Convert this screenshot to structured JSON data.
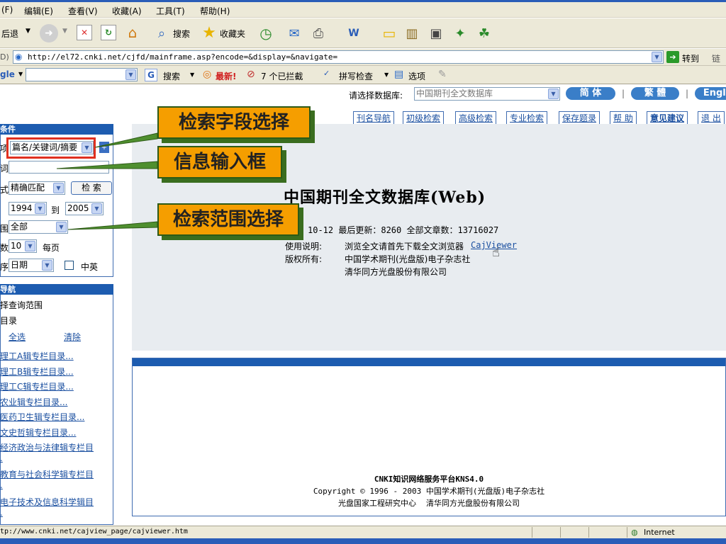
{
  "menu": [
    "(F)",
    "编辑(E)",
    "查看(V)",
    "收藏(A)",
    "工具(T)",
    "帮助(H)"
  ],
  "toolbar": {
    "back": "后退",
    "search": "搜索",
    "favorites": "收藏夹"
  },
  "address": {
    "label": "D)",
    "url": "http://el72.cnki.net/cjfd/mainframe.asp?encode=&display=&navigate=",
    "go": "转到",
    "links": "链接"
  },
  "gbar": {
    "logo": "gle",
    "search": "搜索",
    "new": "最新!",
    "blocked": "7 个已拦截",
    "spell": "拼写检查",
    "options": "选项"
  },
  "db": {
    "label": "请选择数据库:",
    "value": "中国期刊全文数据库",
    "btn_simple": "简 体",
    "btn_trad": "繁 體",
    "btn_en": "Engli"
  },
  "tabs": [
    "刊名导航",
    "初级检索",
    "高级检索",
    "专业检索",
    "保存题录",
    "帮 助",
    "意见建议",
    "退 出"
  ],
  "left": {
    "head1": "条件",
    "field_label": "项",
    "field_value": "篇名/关键词/摘要",
    "word_label": "词",
    "mode_label": "式",
    "mode_value": "精确匹配",
    "search_btn": "检 索",
    "year_from": "1994",
    "year_to_label": "到",
    "year_to": "2005",
    "range_label": "围",
    "range_value": "全部",
    "count_label": "数",
    "count_value": "10",
    "per_page": "每页",
    "sort_label": "序",
    "sort_value": "日期",
    "zhongying": "中英",
    "head2": "导航",
    "choose_range": "择查询范围",
    "catalog": "目录",
    "select_all": "全选",
    "clear": "清除",
    "cats": [
      "理工A辑专栏目录...",
      "理工B辑专栏目录...",
      "理工C辑专栏目录...",
      "农业辑专栏目录...",
      "医药卫生辑专栏目录...",
      "文史哲辑专栏目录...",
      "经济政治与法律辑专栏目",
      ".",
      "教育与社会科学辑专栏目",
      ".",
      "电子技术及信息科学辑目",
      "."
    ]
  },
  "main": {
    "title": "中国期刊全文数据库(Web)",
    "stats": "10-12 最后更新：8260 全部文章数：13716027",
    "usage_label": "使用说明:",
    "usage_text": "浏览全文请首先下载全文浏览器",
    "usage_link": "CajViewer",
    "rights_label": "版权所有:",
    "rights_1": "中国学术期刊(光盘版)电子杂志社",
    "rights_2": "清华同方光盘股份有限公司"
  },
  "footer": {
    "line1": "CNKI知识网络服务平台KNS4.0",
    "line2": "Copyright © 1996 - 2003  中国学术期刊(光盘版)电子杂志社",
    "line3": "光盘国家工程研究中心    清华同方光盘股份有限公司"
  },
  "callouts": {
    "c1": "检索字段选择",
    "c2": "信息输入框",
    "c3": "检索范围选择"
  },
  "status": {
    "url": "tp://www.cnki.net/cajview_page/cajviewer.htm",
    "zone": "Internet"
  },
  "colors": {
    "accent": "#1d5cb0",
    "callout": "#f59e00",
    "callout_border": "#2d5a16"
  }
}
